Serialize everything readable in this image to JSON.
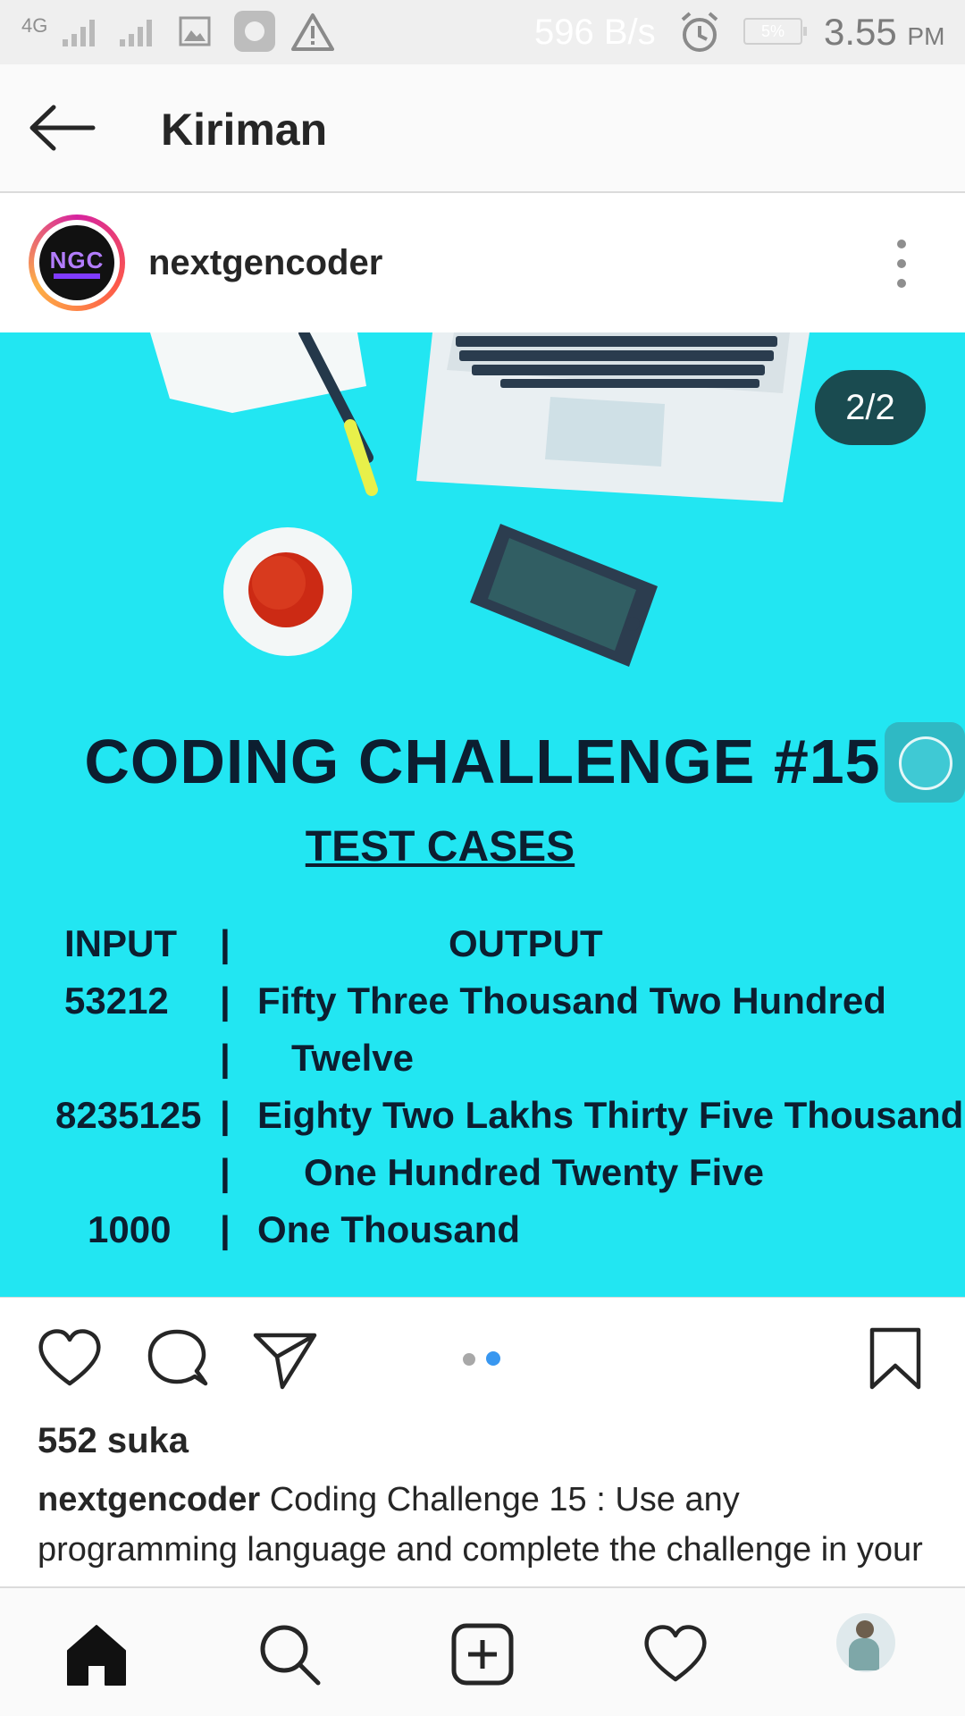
{
  "status_bar": {
    "network": "4G",
    "speed": "596 B/s",
    "battery": "5%",
    "time": "3.55",
    "ampm": "PM"
  },
  "header": {
    "title": "Kiriman"
  },
  "post": {
    "username": "nextgencoder",
    "avatar_text": "NGC",
    "image_counter": "2/2",
    "image": {
      "title": "CODING CHALLENGE  #15",
      "subtitle": "TEST CASES",
      "col_input": "INPUT",
      "col_output": "OUTPUT",
      "rows": [
        {
          "input": "53212",
          "output": "Fifty Three Thousand Two Hundred"
        },
        {
          "input": "",
          "output": "Twelve"
        },
        {
          "input": "8235125",
          "output": "Eighty Two Lakhs Thirty Five Thousand"
        },
        {
          "input": "",
          "output": "One Hundred Twenty Five"
        },
        {
          "input": "1000",
          "output": "One Thousand"
        }
      ],
      "pipe": "|"
    },
    "likes": "552 suka",
    "caption_user": "nextgencoder",
    "caption_text": " Coding Challenge 15 : Use any programming language and complete the challenge in your language on your system with Screenshot of"
  },
  "icons": {
    "back": "back-arrow-icon",
    "more": "more-vertical-icon",
    "like": "heart-icon",
    "comment": "comment-icon",
    "share": "send-icon",
    "save": "bookmark-icon",
    "home": "home-icon",
    "search": "search-icon",
    "add": "add-post-icon",
    "activity": "heart-icon",
    "profile": "profile-avatar"
  },
  "colors": {
    "image_bg": "#22e6f2",
    "dot_active": "#3897f0",
    "dot_inactive": "#a8a8a8"
  }
}
